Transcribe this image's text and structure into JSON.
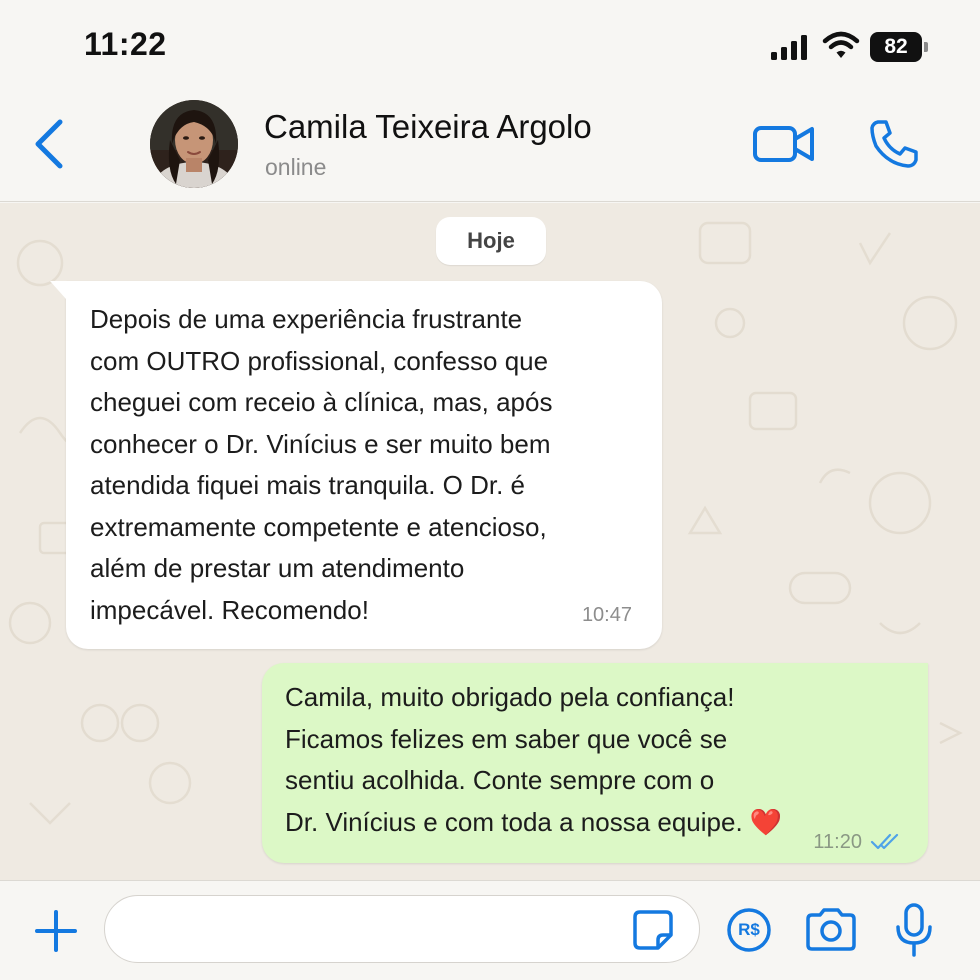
{
  "status_bar": {
    "time": "11:22",
    "battery_level": "82",
    "icons": [
      "signal-icon",
      "wifi-icon",
      "battery-icon"
    ]
  },
  "header": {
    "contact_name": "Camila Teixeira Argolo",
    "contact_status": "online",
    "icons": [
      "chevron-left-icon",
      "video-camera-icon",
      "phone-icon"
    ]
  },
  "chat": {
    "date_label": "Hoje",
    "messages": [
      {
        "direction": "incoming",
        "lines": [
          "Depois de uma experiência frustrante",
          "com OUTRO profissional, confesso que",
          "cheguei com receio à clínica, mas, após",
          "conhecer o Dr. Vinícius e ser muito bem",
          "atendida fiquei mais tranquila. O Dr. é",
          "extremamente competente e atencioso,",
          "além de prestar um atendimento",
          "impecável. Recomendo!"
        ],
        "time": "10:47"
      },
      {
        "direction": "outgoing",
        "lines": [
          "Camila, muito obrigado pela confiança!",
          "Ficamos felizes em saber que você se",
          "sentiu acolhida. Conte sempre com o",
          "Dr. Vinícius e com toda a nossa equipe. ❤️"
        ],
        "time": "11:20",
        "status": "read"
      }
    ]
  },
  "input_bar": {
    "value": "",
    "icons": [
      "plus-icon",
      "sticker-icon",
      "payment-icon",
      "camera-icon",
      "microphone-icon"
    ],
    "payment_label": "R$"
  },
  "colors": {
    "accent": "#1479e0",
    "outgoing_bubble": "#dcf8c6",
    "incoming_bubble": "#ffffff",
    "chat_background": "#efeae2",
    "read_ticks": "#4fa3e8"
  }
}
